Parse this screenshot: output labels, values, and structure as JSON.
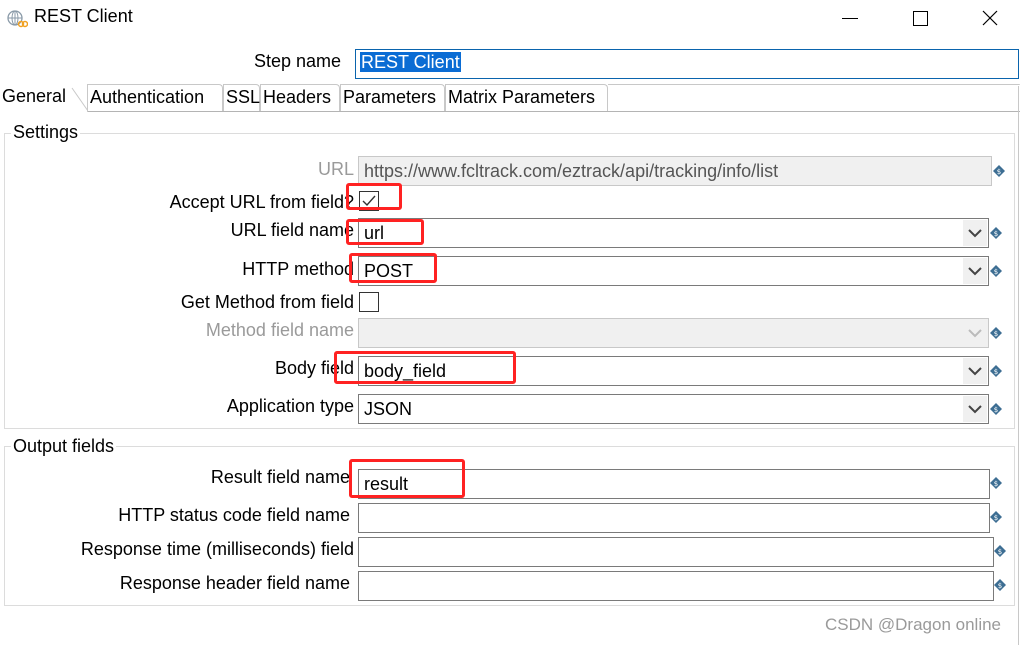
{
  "window": {
    "title": "REST Client",
    "controls": [
      "minimize",
      "maximize",
      "close"
    ]
  },
  "step_name": {
    "label": "Step name",
    "value": "REST Client"
  },
  "tabs": [
    {
      "label": "General",
      "active": true
    },
    {
      "label": "Authentication",
      "active": false
    },
    {
      "label": "SSL",
      "active": false
    },
    {
      "label": "Headers",
      "active": false
    },
    {
      "label": "Parameters",
      "active": false
    },
    {
      "label": "Matrix Parameters",
      "active": false
    }
  ],
  "settings": {
    "title": "Settings",
    "url": {
      "label": "URL",
      "value": "https://www.fcltrack.com/eztrack/api/tracking/info/list",
      "enabled": false
    },
    "accept_url_from_field": {
      "label": "Accept URL from field?",
      "checked": true
    },
    "url_field_name": {
      "label": "URL field name",
      "value": "url"
    },
    "http_method": {
      "label": "HTTP method",
      "value": "POST"
    },
    "get_method_from_field": {
      "label": "Get Method from field",
      "checked": false
    },
    "method_field_name": {
      "label": "Method field name",
      "value": "",
      "enabled": false
    },
    "body_field": {
      "label": "Body field",
      "value": "body_field"
    },
    "application_type": {
      "label": "Application type",
      "value": "JSON"
    }
  },
  "output_fields": {
    "title": "Output fields",
    "result_field_name": {
      "label": "Result field name",
      "value": "result"
    },
    "http_status_code_field_name": {
      "label": "HTTP status code field name",
      "value": ""
    },
    "response_time_field": {
      "label": "Response time (milliseconds) field",
      "value": ""
    },
    "response_header_field_name": {
      "label": "Response header field name",
      "value": ""
    }
  },
  "watermark": "CSDN @Dragon online",
  "colors": {
    "highlight": "#ff2222",
    "selection": "#0a6cd4",
    "variable_icon": "#3d6e93"
  }
}
